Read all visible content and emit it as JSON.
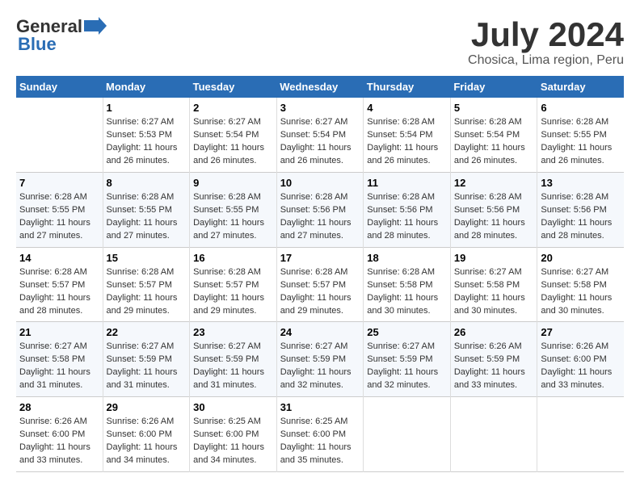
{
  "logo": {
    "general": "General",
    "blue": "Blue"
  },
  "title": "July 2024",
  "subtitle": "Chosica, Lima region, Peru",
  "days_header": [
    "Sunday",
    "Monday",
    "Tuesday",
    "Wednesday",
    "Thursday",
    "Friday",
    "Saturday"
  ],
  "weeks": [
    [
      {
        "day": "",
        "info": ""
      },
      {
        "day": "1",
        "info": "Sunrise: 6:27 AM\nSunset: 5:53 PM\nDaylight: 11 hours\nand 26 minutes."
      },
      {
        "day": "2",
        "info": "Sunrise: 6:27 AM\nSunset: 5:54 PM\nDaylight: 11 hours\nand 26 minutes."
      },
      {
        "day": "3",
        "info": "Sunrise: 6:27 AM\nSunset: 5:54 PM\nDaylight: 11 hours\nand 26 minutes."
      },
      {
        "day": "4",
        "info": "Sunrise: 6:28 AM\nSunset: 5:54 PM\nDaylight: 11 hours\nand 26 minutes."
      },
      {
        "day": "5",
        "info": "Sunrise: 6:28 AM\nSunset: 5:54 PM\nDaylight: 11 hours\nand 26 minutes."
      },
      {
        "day": "6",
        "info": "Sunrise: 6:28 AM\nSunset: 5:55 PM\nDaylight: 11 hours\nand 26 minutes."
      }
    ],
    [
      {
        "day": "7",
        "info": "Sunrise: 6:28 AM\nSunset: 5:55 PM\nDaylight: 11 hours\nand 27 minutes."
      },
      {
        "day": "8",
        "info": "Sunrise: 6:28 AM\nSunset: 5:55 PM\nDaylight: 11 hours\nand 27 minutes."
      },
      {
        "day": "9",
        "info": "Sunrise: 6:28 AM\nSunset: 5:55 PM\nDaylight: 11 hours\nand 27 minutes."
      },
      {
        "day": "10",
        "info": "Sunrise: 6:28 AM\nSunset: 5:56 PM\nDaylight: 11 hours\nand 27 minutes."
      },
      {
        "day": "11",
        "info": "Sunrise: 6:28 AM\nSunset: 5:56 PM\nDaylight: 11 hours\nand 28 minutes."
      },
      {
        "day": "12",
        "info": "Sunrise: 6:28 AM\nSunset: 5:56 PM\nDaylight: 11 hours\nand 28 minutes."
      },
      {
        "day": "13",
        "info": "Sunrise: 6:28 AM\nSunset: 5:56 PM\nDaylight: 11 hours\nand 28 minutes."
      }
    ],
    [
      {
        "day": "14",
        "info": "Sunrise: 6:28 AM\nSunset: 5:57 PM\nDaylight: 11 hours\nand 28 minutes."
      },
      {
        "day": "15",
        "info": "Sunrise: 6:28 AM\nSunset: 5:57 PM\nDaylight: 11 hours\nand 29 minutes."
      },
      {
        "day": "16",
        "info": "Sunrise: 6:28 AM\nSunset: 5:57 PM\nDaylight: 11 hours\nand 29 minutes."
      },
      {
        "day": "17",
        "info": "Sunrise: 6:28 AM\nSunset: 5:57 PM\nDaylight: 11 hours\nand 29 minutes."
      },
      {
        "day": "18",
        "info": "Sunrise: 6:28 AM\nSunset: 5:58 PM\nDaylight: 11 hours\nand 30 minutes."
      },
      {
        "day": "19",
        "info": "Sunrise: 6:27 AM\nSunset: 5:58 PM\nDaylight: 11 hours\nand 30 minutes."
      },
      {
        "day": "20",
        "info": "Sunrise: 6:27 AM\nSunset: 5:58 PM\nDaylight: 11 hours\nand 30 minutes."
      }
    ],
    [
      {
        "day": "21",
        "info": "Sunrise: 6:27 AM\nSunset: 5:58 PM\nDaylight: 11 hours\nand 31 minutes."
      },
      {
        "day": "22",
        "info": "Sunrise: 6:27 AM\nSunset: 5:59 PM\nDaylight: 11 hours\nand 31 minutes."
      },
      {
        "day": "23",
        "info": "Sunrise: 6:27 AM\nSunset: 5:59 PM\nDaylight: 11 hours\nand 31 minutes."
      },
      {
        "day": "24",
        "info": "Sunrise: 6:27 AM\nSunset: 5:59 PM\nDaylight: 11 hours\nand 32 minutes."
      },
      {
        "day": "25",
        "info": "Sunrise: 6:27 AM\nSunset: 5:59 PM\nDaylight: 11 hours\nand 32 minutes."
      },
      {
        "day": "26",
        "info": "Sunrise: 6:26 AM\nSunset: 5:59 PM\nDaylight: 11 hours\nand 33 minutes."
      },
      {
        "day": "27",
        "info": "Sunrise: 6:26 AM\nSunset: 6:00 PM\nDaylight: 11 hours\nand 33 minutes."
      }
    ],
    [
      {
        "day": "28",
        "info": "Sunrise: 6:26 AM\nSunset: 6:00 PM\nDaylight: 11 hours\nand 33 minutes."
      },
      {
        "day": "29",
        "info": "Sunrise: 6:26 AM\nSunset: 6:00 PM\nDaylight: 11 hours\nand 34 minutes."
      },
      {
        "day": "30",
        "info": "Sunrise: 6:25 AM\nSunset: 6:00 PM\nDaylight: 11 hours\nand 34 minutes."
      },
      {
        "day": "31",
        "info": "Sunrise: 6:25 AM\nSunset: 6:00 PM\nDaylight: 11 hours\nand 35 minutes."
      },
      {
        "day": "",
        "info": ""
      },
      {
        "day": "",
        "info": ""
      },
      {
        "day": "",
        "info": ""
      }
    ]
  ]
}
